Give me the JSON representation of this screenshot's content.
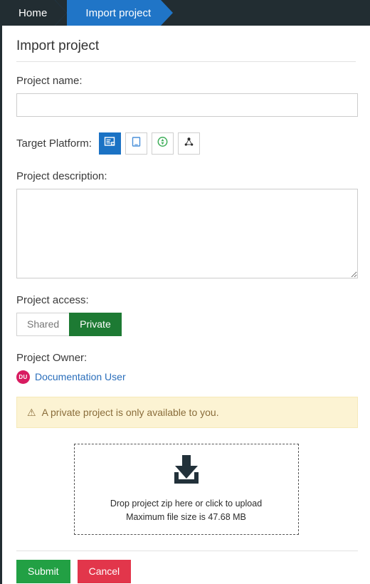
{
  "topbar": {
    "home_label": "Home",
    "breadcrumb_label": "Import project",
    "bg_color": "#222d32",
    "crumb_color": "#2075c7"
  },
  "page": {
    "title": "Import project"
  },
  "form": {
    "project_name": {
      "label": "Project name:",
      "value": "",
      "placeholder": ""
    },
    "target_platform": {
      "label": "Target Platform:",
      "options": [
        {
          "name": "desktop-form-icon",
          "selected": true
        },
        {
          "name": "tablet-icon",
          "selected": false
        },
        {
          "name": "refresh-circle-icon",
          "selected": false
        },
        {
          "name": "network-nodes-icon",
          "selected": false
        }
      ]
    },
    "project_description": {
      "label": "Project description:",
      "value": "",
      "placeholder": ""
    },
    "project_access": {
      "label": "Project access:",
      "options": [
        "Shared",
        "Private"
      ],
      "selected": "Private",
      "active_color": "#1d7a33"
    },
    "project_owner": {
      "label": "Project Owner:",
      "avatar_initials": "DU",
      "avatar_color": "#d81b60",
      "name": "Documentation User",
      "link_color": "#2a6ebb"
    },
    "alert": {
      "icon": "warning-triangle-icon",
      "text": "A private project is only available to you.",
      "bg_color": "#fcf3d3",
      "text_color": "#8a6d3b"
    },
    "dropzone": {
      "icon": "download-tray-icon",
      "line1": "Drop project zip here or click to upload",
      "line2": "Maximum file size is 47.68 MB"
    }
  },
  "footer": {
    "submit_label": "Submit",
    "cancel_label": "Cancel",
    "submit_color": "#22a044",
    "cancel_color": "#e2364b"
  }
}
